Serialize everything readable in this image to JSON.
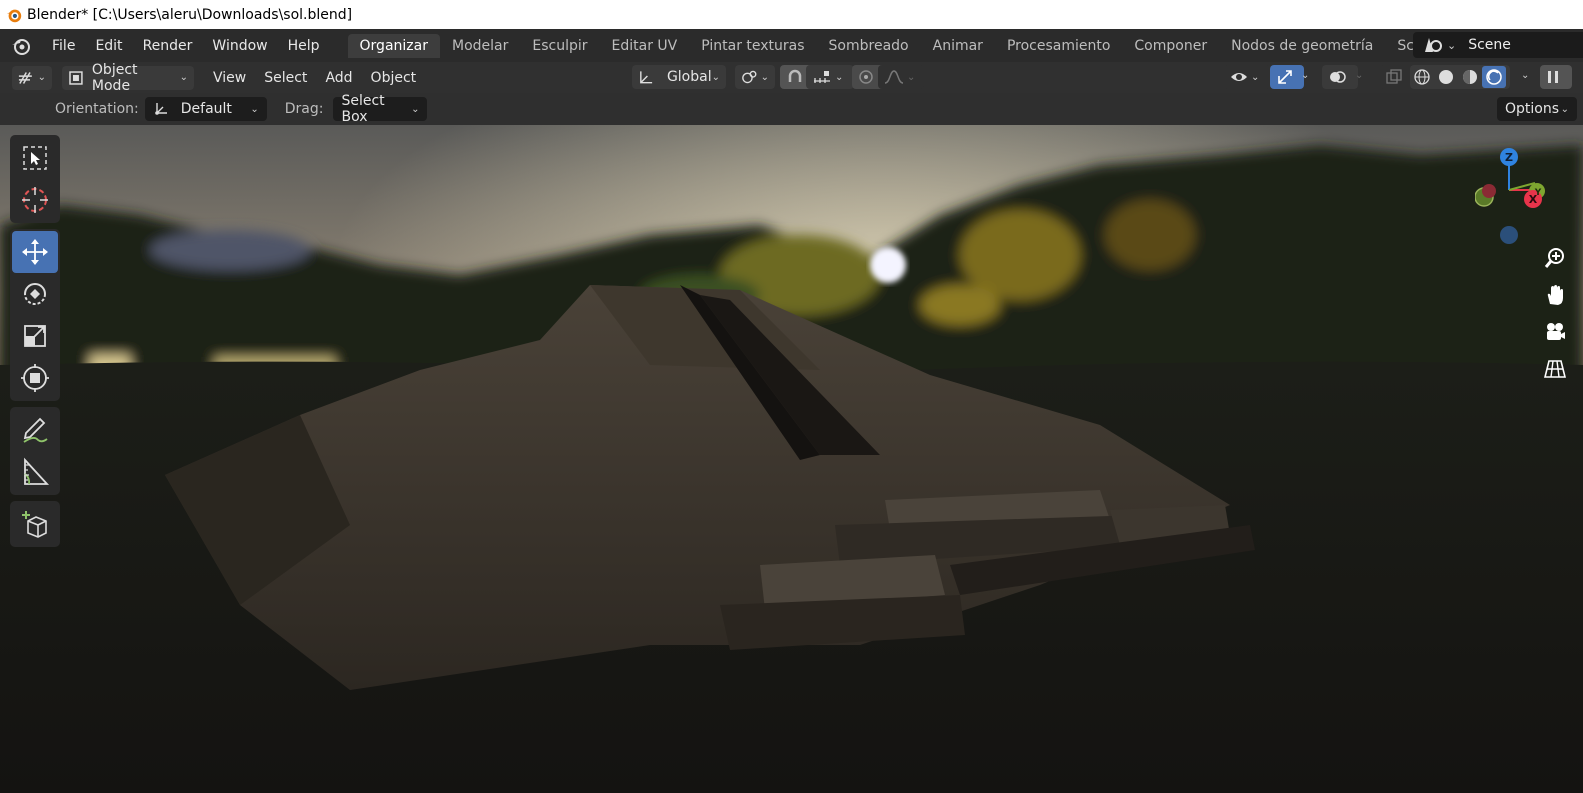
{
  "window": {
    "title": "Blender* [C:\\Users\\aleru\\Downloads\\sol.blend]"
  },
  "menubar": {
    "menus": [
      "File",
      "Edit",
      "Render",
      "Window",
      "Help"
    ],
    "workspaces": [
      "Organizar",
      "Modelar",
      "Esculpir",
      "Editar UV",
      "Pintar texturas",
      "Sombreado",
      "Animar",
      "Procesamiento",
      "Componer",
      "Nodos de geometría",
      "Scripts"
    ],
    "active_workspace": "Organizar",
    "add_workspace_label": "+",
    "scene_name": "Scene"
  },
  "header": {
    "mode": "Object Mode",
    "menus": [
      "View",
      "Select",
      "Add",
      "Object"
    ],
    "transform_orientation": "Global"
  },
  "tool_settings": {
    "orientation_label": "Orientation:",
    "orientation_value": "Default",
    "drag_label": "Drag:",
    "drag_value": "Select Box",
    "options_label": "Options"
  },
  "toolbar": {
    "tools": [
      "select-box",
      "cursor",
      "move",
      "rotate",
      "scale",
      "transform",
      "annotate",
      "measure",
      "add-cube"
    ],
    "active_tool": "move"
  },
  "gizmo": {
    "axes": {
      "z": "Z",
      "y": "Y",
      "x": "X"
    },
    "colors": {
      "x": "#e8344b",
      "y": "#7ea630",
      "z": "#2f83e0"
    }
  },
  "colors": {
    "accent": "#4772b3",
    "menubar_bg": "#2b2b2b",
    "header_bg": "#303030"
  }
}
